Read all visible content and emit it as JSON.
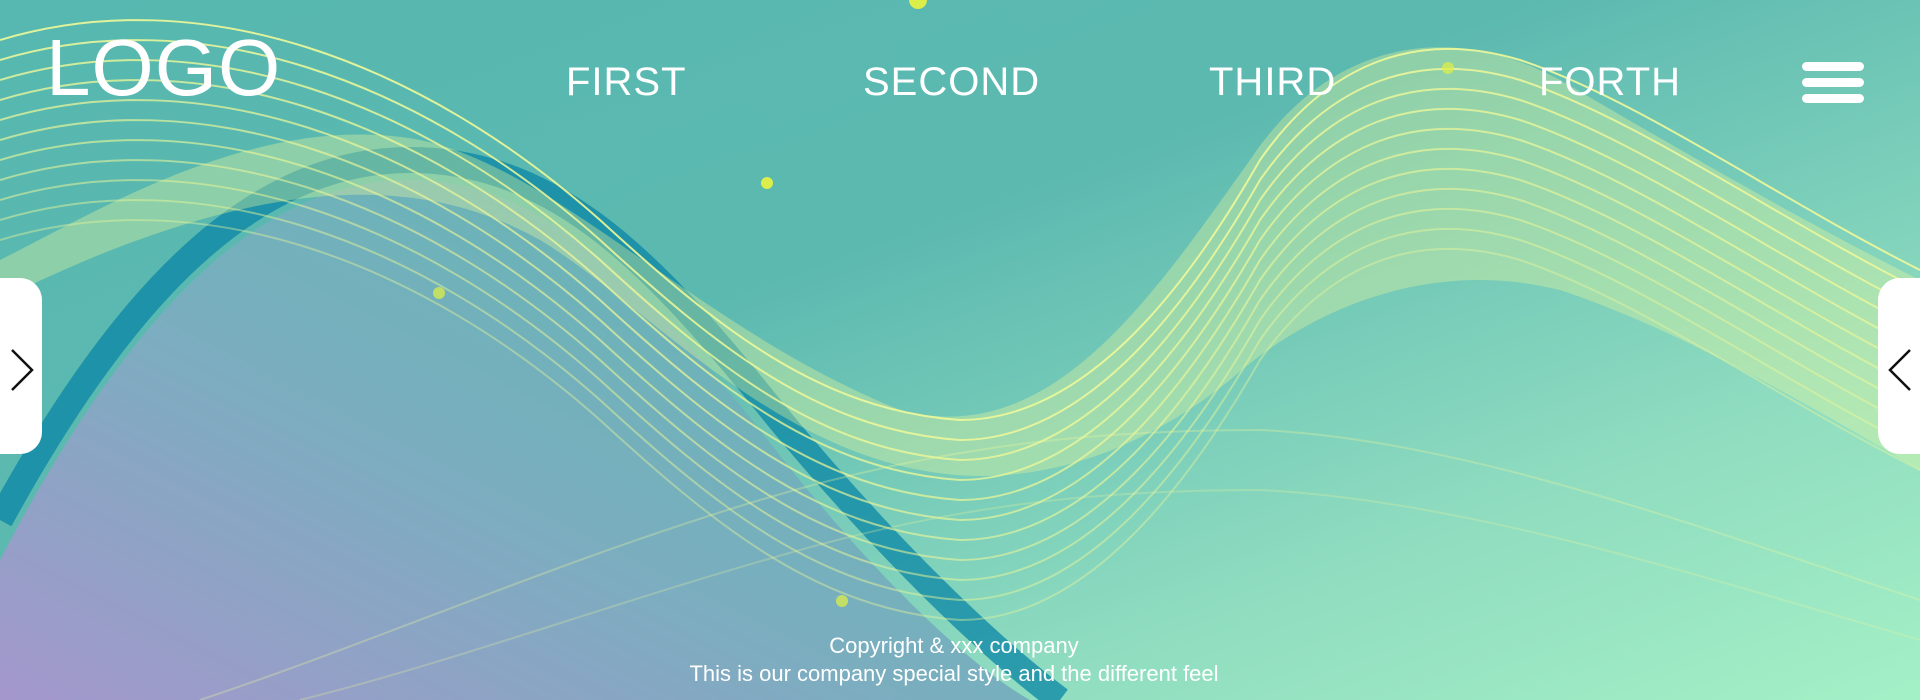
{
  "header": {
    "logo": "LOGO",
    "nav": [
      {
        "label": "FIRST"
      },
      {
        "label": "SECOND"
      },
      {
        "label": "THIRD"
      },
      {
        "label": "FORTH"
      }
    ],
    "menu_icon": "hamburger-menu-icon"
  },
  "carousel": {
    "prev_icon": "chevron-right-icon",
    "next_icon": "chevron-left-icon"
  },
  "footer": {
    "copyright": "Copyright & xxx company",
    "tagline": "This is our company special style and the different feel"
  },
  "colors": {
    "background_teal": "#5cb9b0",
    "background_mint": "#a4f0c6",
    "wave_yellow": "#eef89a",
    "wave_blue": "#0a86a6",
    "lower_purple": "#a497cc",
    "dot_yellow": "#dcee4a",
    "text": "#ffffff"
  }
}
